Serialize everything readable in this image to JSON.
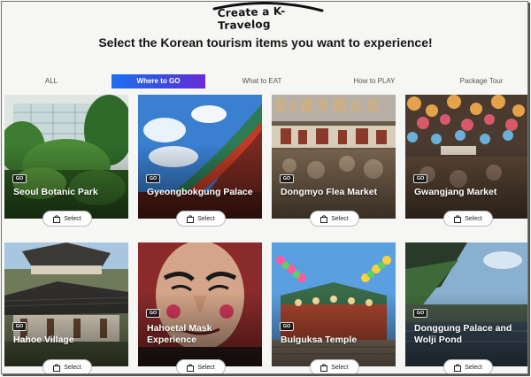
{
  "header": {
    "logo_text": "Create a K-Travelog",
    "subtitle": "Select the Korean tourism items you want to experience!"
  },
  "tabs": [
    {
      "label": "ALL",
      "active": false
    },
    {
      "label": "Where to GO",
      "active": true
    },
    {
      "label": "What to EAT",
      "active": false
    },
    {
      "label": "How to PLAY",
      "active": false
    },
    {
      "label": "Package Tour",
      "active": false
    }
  ],
  "cards": [
    {
      "title": "Seoul Botanic Park",
      "badge": "GO",
      "button": "Select"
    },
    {
      "title": "Gyeongbokgung Palace",
      "badge": "GO",
      "button": "Select"
    },
    {
      "title": "Dongmyo Flea Market",
      "badge": "GO",
      "button": "Select"
    },
    {
      "title": "Gwangjang Market",
      "badge": "GO",
      "button": "Select"
    },
    {
      "title": "Hahoe Village",
      "badge": "GO",
      "button": "Select"
    },
    {
      "title": "Hahoetal Mask Experience",
      "badge": "GO",
      "button": "Select"
    },
    {
      "title": "Bulguksa Temple",
      "badge": "GO",
      "button": "Select"
    },
    {
      "title": "Donggung Palace and Wolji Pond",
      "badge": "GO",
      "button": "Select"
    }
  ],
  "icons": {
    "select": "shopping-bag-icon"
  },
  "colors": {
    "tab_active_start": "#1f6ff0",
    "tab_active_end": "#6a2bd8"
  }
}
